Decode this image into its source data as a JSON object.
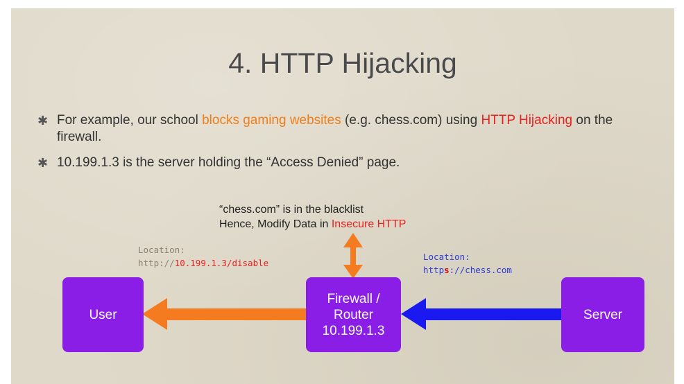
{
  "title": "4. HTTP Hijacking",
  "bullets": [
    {
      "pre": "For example, our school ",
      "highlight1": "blocks gaming websites",
      "mid": " (e.g. chess.com) using ",
      "highlight2": "HTTP Hijacking",
      "post": " on the firewall."
    },
    {
      "text": "10.199.1.3 is the server holding the “Access Denied” page."
    }
  ],
  "note": {
    "line1": "“chess.com” is in the blacklist",
    "line2_pre": "Hence, Modify Data in ",
    "line2_highlight": "Insecure HTTP"
  },
  "location_left": {
    "label": "Location:",
    "prefix": "http://",
    "url_rest": "10.199.1.3/disable"
  },
  "location_right": {
    "label": "Location:",
    "p1": "http",
    "p2": "s",
    "p3": "://chess.com"
  },
  "boxes": {
    "user": "User",
    "firewall_line1": "Firewall /",
    "firewall_line2": "Router",
    "firewall_line3": "10.199.1.3",
    "server": "Server"
  },
  "colors": {
    "box": "#8b1ee6",
    "orange_arrow": "#f47b20",
    "blue_arrow": "#1a1af0",
    "highlight_orange": "#f07d1a",
    "highlight_red": "#e8201e"
  },
  "icons": [
    "star-bullet-icon",
    "left-arrow-orange",
    "left-arrow-blue",
    "double-vertical-arrow-orange"
  ]
}
